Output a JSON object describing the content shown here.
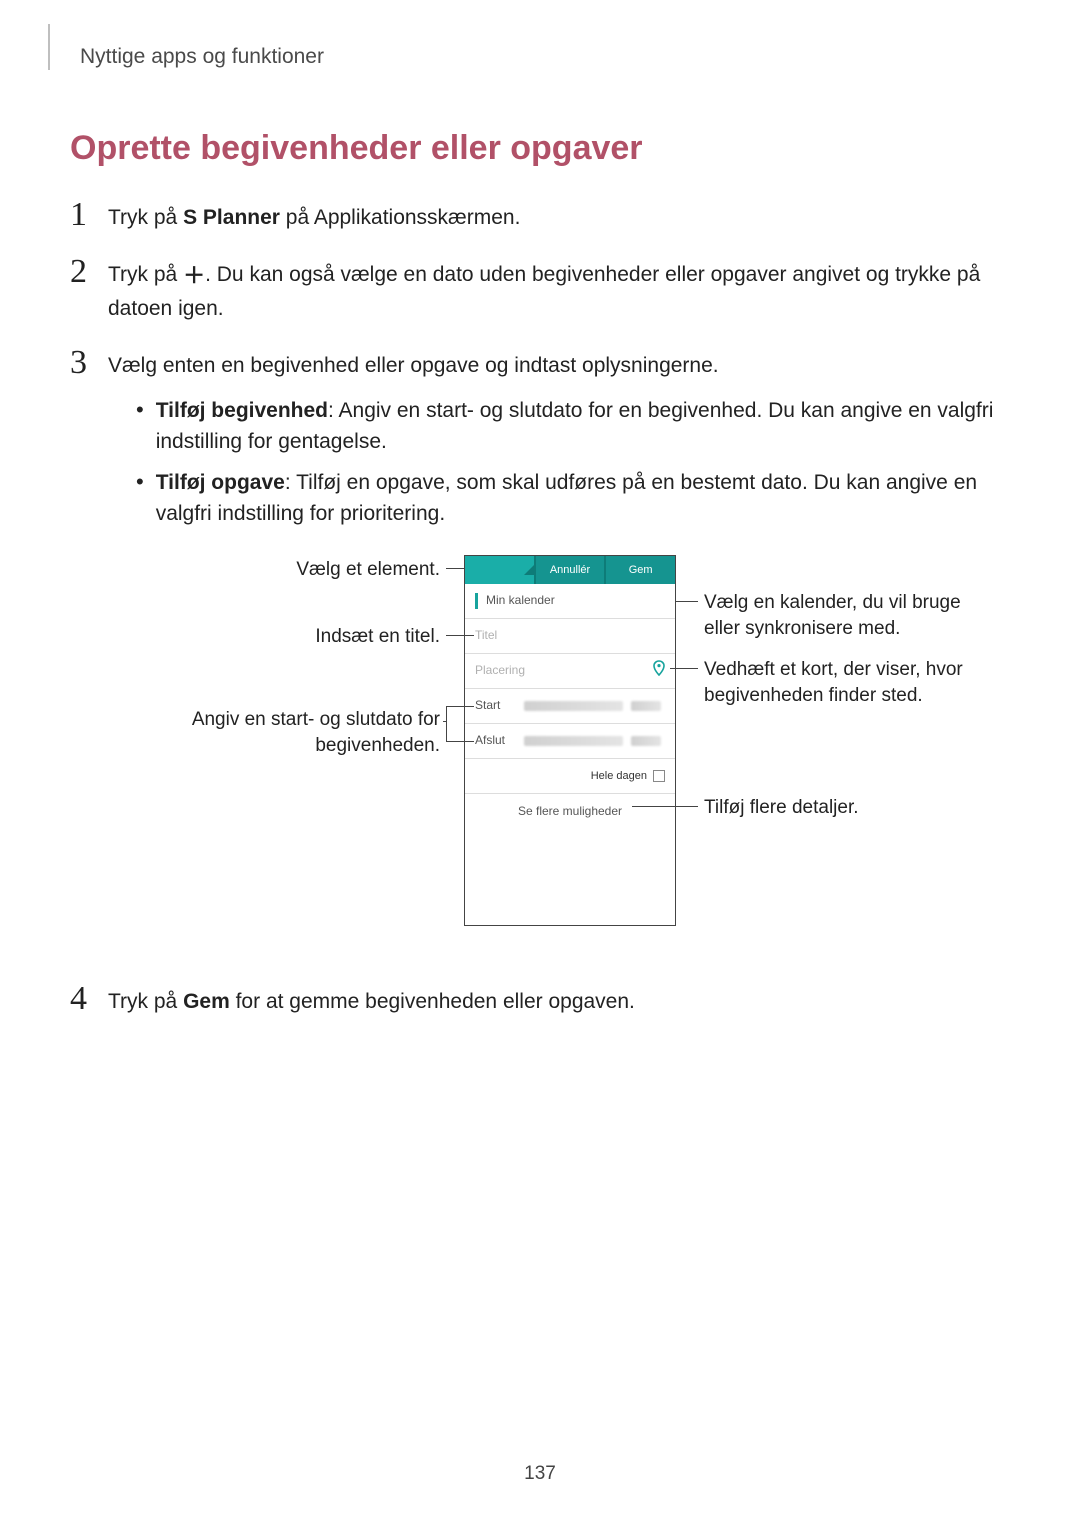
{
  "breadcrumb": "Nyttige apps og funktioner",
  "heading": "Oprette begivenheder eller opgaver",
  "steps": {
    "s1": {
      "num": "1",
      "pre": "Tryk på ",
      "bold": "S Planner",
      "post": " på Applikationsskærmen."
    },
    "s2": {
      "num": "2",
      "pre": "Tryk på ",
      "post": ". Du kan også vælge en dato uden begivenheder eller opgaver angivet og trykke på datoen igen."
    },
    "s3": {
      "num": "3",
      "text": "Vælg enten en begivenhed eller opgave og indtast oplysningerne.",
      "bullets": [
        {
          "bold": "Tilføj begivenhed",
          "rest": ": Angiv en start- og slutdato for en begivenhed. Du kan angive en valgfri indstilling for gentagelse."
        },
        {
          "bold": "Tilføj opgave",
          "rest": ": Tilføj en opgave, som skal udføres på en bestemt dato. Du kan angive en valgfri indstilling for prioritering."
        }
      ]
    },
    "s4": {
      "num": "4",
      "pre": "Tryk på ",
      "bold": "Gem",
      "post": " for at gemme begivenheden eller opgaven."
    }
  },
  "phone": {
    "tabs": {
      "cancel": "Annullér",
      "save": "Gem"
    },
    "calendar": "Min kalender",
    "title_placeholder": "Titel",
    "location_placeholder": "Placering",
    "start": "Start",
    "end": "Afslut",
    "allday": "Hele dagen",
    "more": "Se flere muligheder"
  },
  "callouts": {
    "element": "Vælg et element.",
    "title": "Indsæt en titel.",
    "dates_l1": "Angiv en start- og slutdato for",
    "dates_l2": "begivenheden.",
    "calendar_l1": "Vælg en kalender, du vil bruge",
    "calendar_l2": "eller synkronisere med.",
    "map_l1": "Vedhæft et kort, der viser, hvor",
    "map_l2": "begivenheden finder sted.",
    "more": "Tilføj flere detaljer."
  },
  "page_number": "137"
}
